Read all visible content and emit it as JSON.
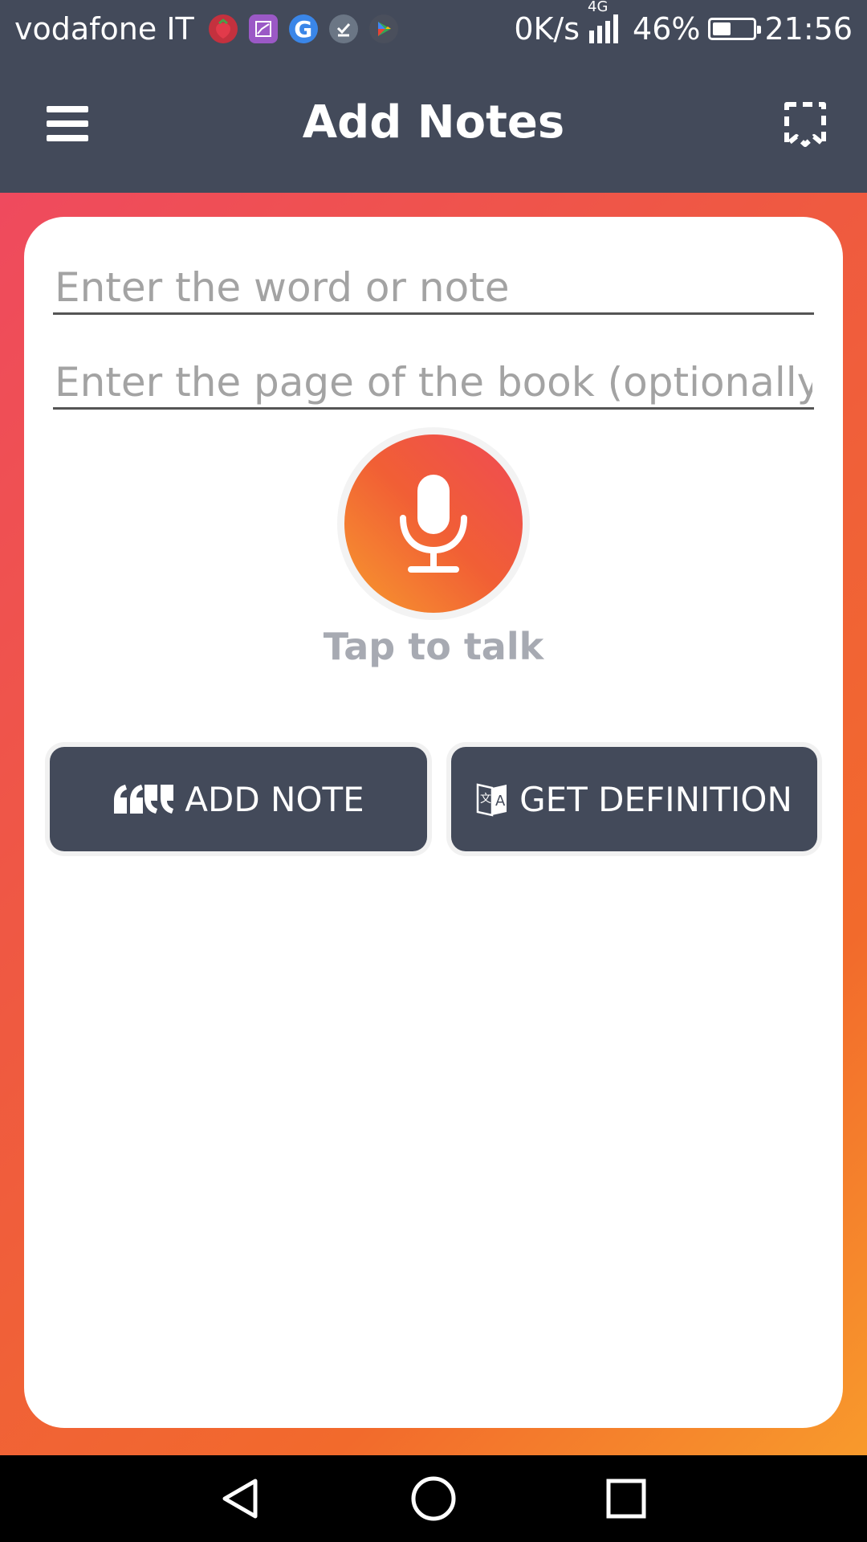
{
  "status_bar": {
    "carrier": "vodafone IT",
    "notification_icons": [
      "strawberry-app-icon",
      "image-app-icon",
      "google-icon",
      "tasks-icon",
      "play-store-icon"
    ],
    "net_speed": "0K/s",
    "network_type": "4G",
    "battery_percent": "46%",
    "battery_level": 0.46,
    "time": "21:56"
  },
  "app_bar": {
    "title": "Add Notes",
    "left_icon": "menu-icon",
    "right_icon": "bookmark-icon"
  },
  "form": {
    "word_placeholder": "Enter the word or note",
    "word_value": "",
    "page_placeholder": "Enter the page of the book (optionally)",
    "page_value": ""
  },
  "mic": {
    "icon": "microphone-icon",
    "label": "Tap to talk"
  },
  "actions": {
    "add_note_label": "ADD NOTE",
    "add_note_icon": "quote-icon",
    "get_definition_label": "GET DEFINITION",
    "get_definition_icon": "translate-icon"
  },
  "colors": {
    "bar": "#434a5a",
    "gradient_start": "#ef4a5e",
    "gradient_end": "#f89a2c",
    "label_gray": "#a7aab2"
  },
  "nav_bar": {
    "icons": [
      "back-icon",
      "home-icon",
      "recents-icon"
    ]
  }
}
